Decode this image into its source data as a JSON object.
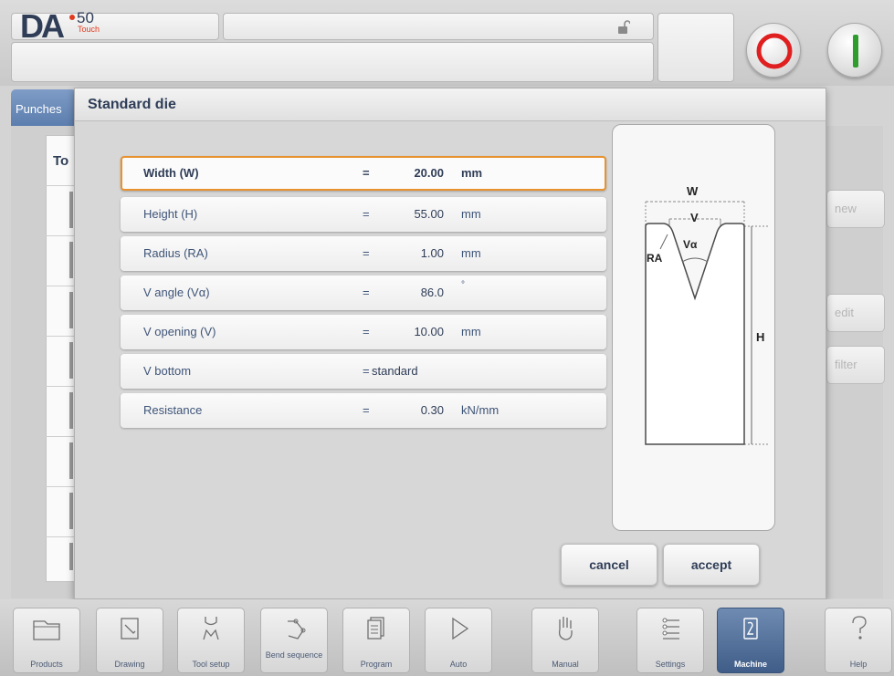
{
  "logo": {
    "brand": "DA",
    "model": "50",
    "sub": "Touch"
  },
  "background": {
    "tab_punches": "Punches",
    "list_header": "To",
    "side_buttons": {
      "new": "new",
      "edit": "edit",
      "filter": "filter"
    }
  },
  "dialog": {
    "title": "Standard die",
    "params": [
      {
        "label": "Width (W)",
        "eq": "=",
        "value": "20.00",
        "unit": "mm"
      },
      {
        "label": "Height (H)",
        "eq": "=",
        "value": "55.00",
        "unit": "mm"
      },
      {
        "label": "Radius (RA)",
        "eq": "=",
        "value": "1.00",
        "unit": "mm"
      },
      {
        "label": "V angle (Vα)",
        "eq": "=",
        "value": "86.0",
        "unit": "°"
      },
      {
        "label": "V opening (V)",
        "eq": "=",
        "value": "10.00",
        "unit": "mm"
      },
      {
        "label": "V bottom",
        "eq": "=",
        "value": "standard",
        "unit": ""
      },
      {
        "label": "Resistance",
        "eq": "=",
        "value": "0.30",
        "unit": "kN/mm"
      }
    ],
    "illustration": {
      "w": "W",
      "v": "V",
      "va": "Vα",
      "ra": "RA",
      "h": "H"
    },
    "cancel_label": "cancel",
    "accept_label": "accept"
  },
  "nav": [
    {
      "label": "Products",
      "icon": "folder-icon"
    },
    {
      "label": "Drawing",
      "icon": "drawing-icon"
    },
    {
      "label": "Tool setup",
      "icon": "tool-setup-icon"
    },
    {
      "label": "Bend sequence",
      "icon": "bend-sequence-icon"
    },
    {
      "label": "Program",
      "icon": "program-icon"
    },
    {
      "label": "Auto",
      "icon": "play-icon"
    },
    {
      "label": "Manual",
      "icon": "hand-icon"
    },
    {
      "label": "Settings",
      "icon": "settings-icon"
    },
    {
      "label": "Machine",
      "icon": "machine-icon",
      "active": true
    },
    {
      "label": "Help",
      "icon": "help-icon"
    }
  ],
  "colors": {
    "accent_orange": "#e8922e",
    "active_blue": "#4f6d98",
    "stop_red": "#e02020"
  }
}
